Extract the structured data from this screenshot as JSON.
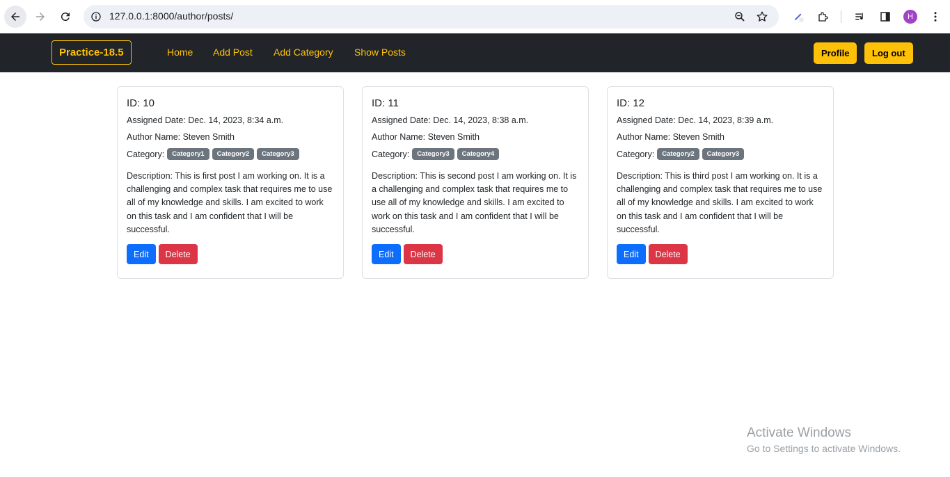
{
  "browser": {
    "url": "127.0.0.1:8000/author/posts/",
    "profile_initial": "H"
  },
  "navbar": {
    "brand": "Practice-18.5",
    "links": [
      "Home",
      "Add Post",
      "Add Category",
      "Show Posts"
    ],
    "profile_label": "Profile",
    "logout_label": "Log out"
  },
  "posts": [
    {
      "id": "ID: 10",
      "assigned": "Assigned Date: Dec. 14, 2023, 8:34 a.m.",
      "author": "Author Name: Steven Smith",
      "category_label": "Category:",
      "categories": [
        "Category1",
        "Category2",
        "Category3"
      ],
      "description": "Description: This is first post I am working on. It is a challenging and complex task that requires me to use all of my knowledge and skills. I am excited to work on this task and I am confident that I will be successful.",
      "edit_label": "Edit",
      "delete_label": "Delete"
    },
    {
      "id": "ID: 11",
      "assigned": "Assigned Date: Dec. 14, 2023, 8:38 a.m.",
      "author": "Author Name: Steven Smith",
      "category_label": "Category:",
      "categories": [
        "Category3",
        "Category4"
      ],
      "description": "Description: This is second post I am working on. It is a challenging and complex task that requires me to use all of my knowledge and skills. I am excited to work on this task and I am confident that I will be successful.",
      "edit_label": "Edit",
      "delete_label": "Delete"
    },
    {
      "id": "ID: 12",
      "assigned": "Assigned Date: Dec. 14, 2023, 8:39 a.m.",
      "author": "Author Name: Steven Smith",
      "category_label": "Category:",
      "categories": [
        "Category2",
        "Category3"
      ],
      "description": "Description: This is third post I am working on. It is a challenging and complex task that requires me to use all of my knowledge and skills. I am excited to work on this task and I am confident that I will be successful.",
      "edit_label": "Edit",
      "delete_label": "Delete"
    }
  ],
  "watermark": {
    "title": "Activate Windows",
    "subtitle": "Go to Settings to activate Windows."
  },
  "colors": {
    "navbar_bg": "#212529",
    "accent_yellow": "#ffc107",
    "edit_blue": "#0d6efd",
    "delete_red": "#dc3545",
    "badge_gray": "#6c757d"
  }
}
